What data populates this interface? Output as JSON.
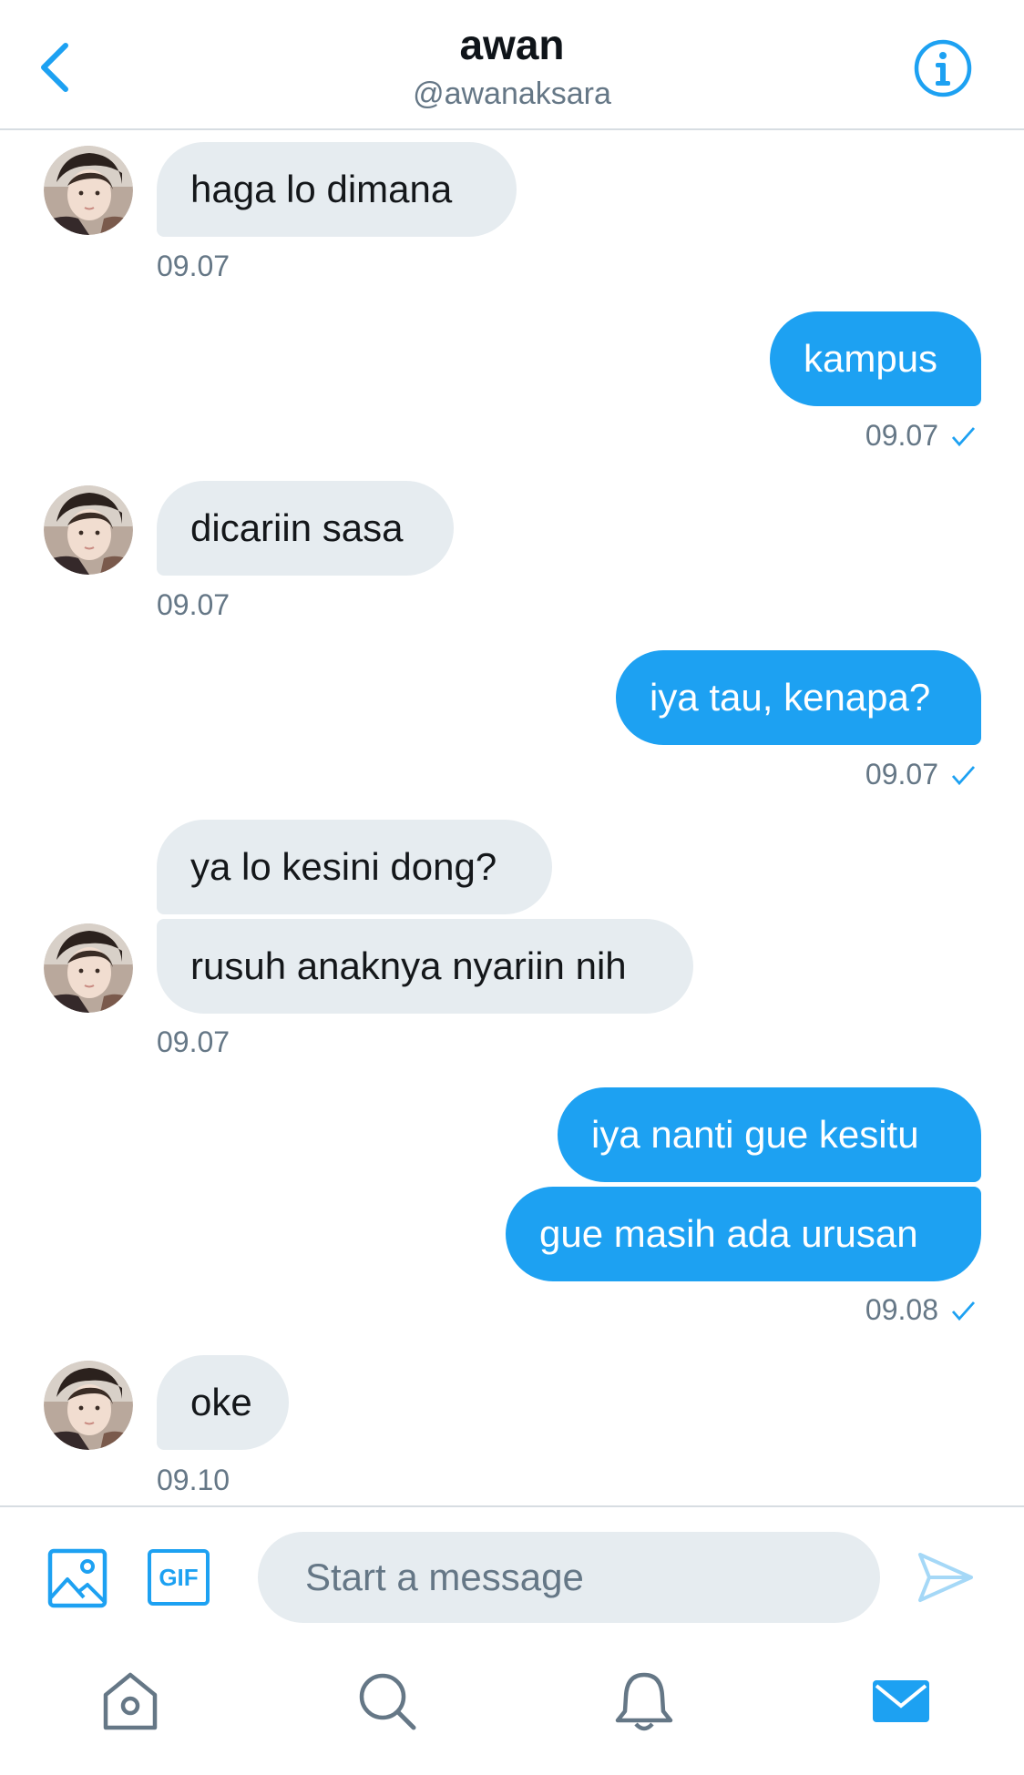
{
  "header": {
    "title": "awan",
    "handle": "@awanaksara",
    "back_icon": "chevron-left-icon",
    "info_icon": "info-icon",
    "accent": "#1da1f2"
  },
  "messages": [
    {
      "text": "haga lo dimana",
      "time": "09.07"
    },
    {
      "text": "kampus",
      "time": "09.07"
    },
    {
      "text": "dicariin sasa",
      "time": "09.07"
    },
    {
      "text": "iya tau, kenapa?",
      "time": "09.07"
    },
    {
      "text": "ya lo kesini dong?"
    },
    {
      "text": "rusuh anaknya nyariin nih",
      "time": "09.07"
    },
    {
      "text": "iya nanti gue kesitu"
    },
    {
      "text": "gue masih ada urusan",
      "time": "09.08"
    },
    {
      "text": "oke",
      "time": "09.10"
    }
  ],
  "composer": {
    "placeholder": "Start a message",
    "gif_label": "GIF"
  },
  "colors": {
    "incoming_bubble": "#e6ecf0",
    "outgoing_bubble": "#1da1f2",
    "muted_text": "#657786"
  },
  "tabs": [
    {
      "icon": "home-icon"
    },
    {
      "icon": "search-icon"
    },
    {
      "icon": "notifications-bell-icon"
    },
    {
      "icon": "messages-mail-icon",
      "active": true
    }
  ]
}
